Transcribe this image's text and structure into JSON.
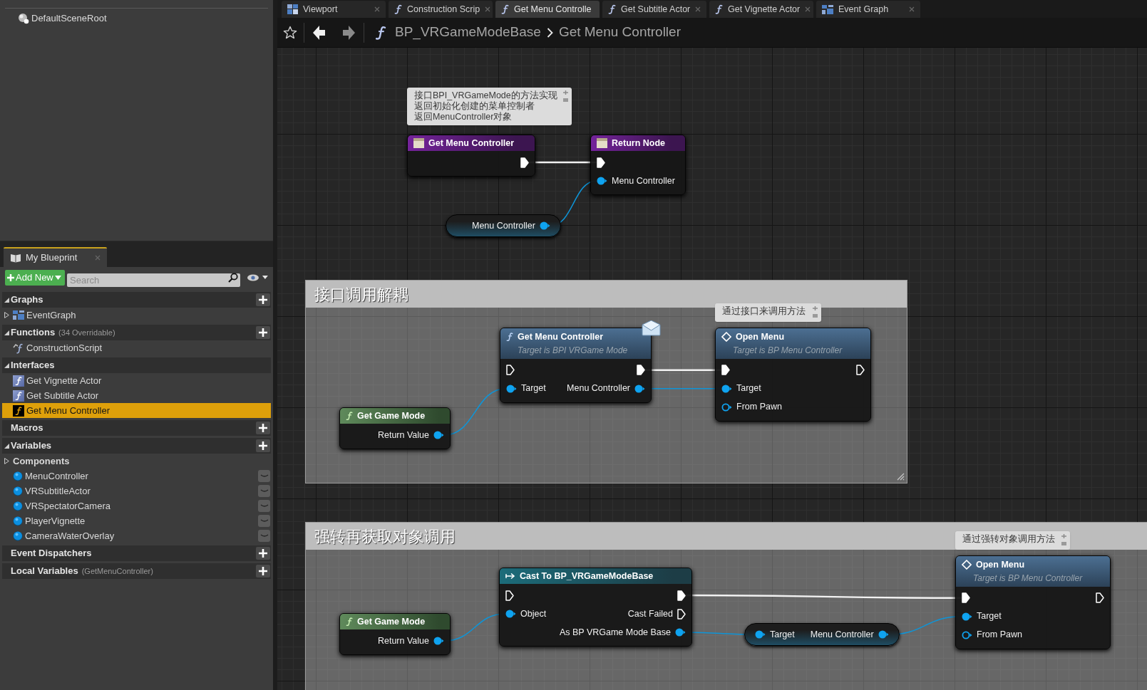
{
  "components_panel": {
    "items": [
      {
        "label": "DefaultSceneRoot"
      }
    ]
  },
  "my_blueprint": {
    "tab": {
      "label": "My Blueprint"
    },
    "add_new": "Add New",
    "search": {
      "placeholder": "Search"
    },
    "sections": [
      {
        "title": "Graphs",
        "expanded": true,
        "can_add": true,
        "items": [
          {
            "label": "EventGraph",
            "kind": "graph",
            "expanded": false,
            "selected": false
          }
        ]
      },
      {
        "title": "Functions",
        "note": "(34 Overridable)",
        "expanded": true,
        "can_add": true,
        "items": [
          {
            "label": "ConstructionScript",
            "kind": "construction",
            "selected": false
          }
        ]
      },
      {
        "title": "Interfaces",
        "expanded": true,
        "can_add": false,
        "items": [
          {
            "label": "Get Vignette Actor",
            "kind": "interface",
            "selected": false
          },
          {
            "label": "Get Subtitle Actor",
            "kind": "interface",
            "selected": false
          },
          {
            "label": "Get Menu Controller",
            "kind": "interface",
            "selected": true
          }
        ]
      },
      {
        "title": "Macros",
        "can_add": true
      },
      {
        "title": "Variables",
        "expanded": true,
        "can_add": true,
        "items": [
          {
            "label": "Components",
            "kind": "category",
            "expanded": false,
            "selected": false
          },
          {
            "label": "MenuController",
            "kind": "variable",
            "selected": false
          },
          {
            "label": "VRSubtitleActor",
            "kind": "variable",
            "selected": false
          },
          {
            "label": "VRSpectatorCamera",
            "kind": "variable",
            "selected": false
          },
          {
            "label": "PlayerVignette",
            "kind": "variable",
            "selected": false
          },
          {
            "label": "CameraWaterOverlay",
            "kind": "variable",
            "selected": false
          }
        ]
      },
      {
        "title": "Event Dispatchers",
        "can_add": true
      },
      {
        "title": "Local Variables",
        "note": "(GetMenuController)",
        "can_add": true
      }
    ]
  },
  "tabs": [
    {
      "label": "Viewport",
      "kind": "viewport",
      "selected": false
    },
    {
      "label": "Construction Scrip",
      "kind": "function",
      "selected": false
    },
    {
      "label": "Get Menu Controlle",
      "kind": "function",
      "selected": true
    },
    {
      "label": "Get Subtitle Actor",
      "kind": "function",
      "selected": false
    },
    {
      "label": "Get Vignette Actor",
      "kind": "function",
      "selected": false
    },
    {
      "label": "Event Graph",
      "kind": "graph",
      "selected": false
    }
  ],
  "breadcrumb": {
    "path": [
      "BP_VRGameModeBase",
      "Get Menu Controller"
    ]
  },
  "graph": {
    "comment_groups": [
      {
        "title": "接口调用解耦"
      },
      {
        "title": "强转再获取对象调用"
      }
    ],
    "comment_bubbles": [
      {
        "lines": [
          "接口BPI_VRGameMode的方法实现",
          "返回初始化创建的菜单控制者",
          "返回MenuController对象"
        ]
      },
      {
        "lines": [
          "通过接口来调用方法"
        ]
      },
      {
        "lines": [
          "通过强转对象调用方法"
        ]
      }
    ],
    "nodes": [
      {
        "kind": "entry",
        "title": "Get Menu Controller",
        "rows": [
          {
            "right": {
              "kind": "exec",
              "connected": true
            }
          }
        ]
      },
      {
        "kind": "return",
        "title": "Return Node",
        "rows": [
          {
            "left": {
              "kind": "exec",
              "connected": true
            }
          },
          {
            "left": {
              "kind": "data",
              "label": "Menu Controller",
              "connected": true
            }
          }
        ]
      },
      {
        "kind": "variable",
        "rows": [
          {
            "right": {
              "kind": "data",
              "label": "Menu Controller",
              "connected": true
            }
          }
        ]
      },
      {
        "kind": "pure",
        "title": "Get Game Mode",
        "rows": [
          {
            "right": {
              "kind": "data",
              "label": "Return Value",
              "connected": true
            }
          }
        ]
      },
      {
        "kind": "interface_call",
        "title": "Get Menu Controller",
        "subtitle": "Target is BPI VRGame Mode",
        "rows": [
          {
            "left": {
              "kind": "exec",
              "connected": false
            },
            "right": {
              "kind": "exec",
              "connected": true
            }
          },
          {
            "left": {
              "kind": "data",
              "label": "Target",
              "connected": true
            },
            "right": {
              "kind": "data",
              "label": "Menu Controller",
              "connected": true
            }
          }
        ]
      },
      {
        "kind": "call",
        "title": "Open Menu",
        "subtitle": "Target is BP Menu Controller",
        "rows": [
          {
            "left": {
              "kind": "exec",
              "connected": true
            },
            "right": {
              "kind": "exec",
              "connected": false
            }
          },
          {
            "left": {
              "kind": "data",
              "label": "Target",
              "connected": true
            }
          },
          {
            "left": {
              "kind": "data",
              "label": "From Pawn",
              "connected": false
            }
          }
        ]
      },
      {
        "kind": "pure",
        "title": "Get Game Mode",
        "rows": [
          {
            "right": {
              "kind": "data",
              "label": "Return Value",
              "connected": true
            }
          }
        ]
      },
      {
        "kind": "cast",
        "title": "Cast To BP_VRGameModeBase",
        "rows": [
          {
            "left": {
              "kind": "exec",
              "connected": false
            },
            "right": {
              "kind": "exec",
              "connected": true
            }
          },
          {
            "left": {
              "kind": "data",
              "label": "Object",
              "connected": true
            },
            "right": {
              "kind": "exec",
              "label": "Cast Failed",
              "connected": false
            }
          },
          {
            "right": {
              "kind": "data",
              "label": "As BP VRGame Mode Base",
              "connected": true
            }
          }
        ]
      },
      {
        "kind": "variable",
        "rows": [
          {
            "left": {
              "kind": "data",
              "label": "Target",
              "connected": true
            },
            "right": {
              "kind": "data",
              "label": "Menu Controller",
              "connected": true
            }
          }
        ]
      },
      {
        "kind": "call",
        "title": "Open Menu",
        "subtitle": "Target is BP Menu Controller",
        "rows": [
          {
            "left": {
              "kind": "exec",
              "connected": true
            },
            "right": {
              "kind": "exec",
              "connected": false
            }
          },
          {
            "left": {
              "kind": "data",
              "label": "Target",
              "connected": true
            }
          },
          {
            "left": {
              "kind": "data",
              "label": "From Pawn",
              "connected": false
            }
          }
        ]
      }
    ]
  }
}
